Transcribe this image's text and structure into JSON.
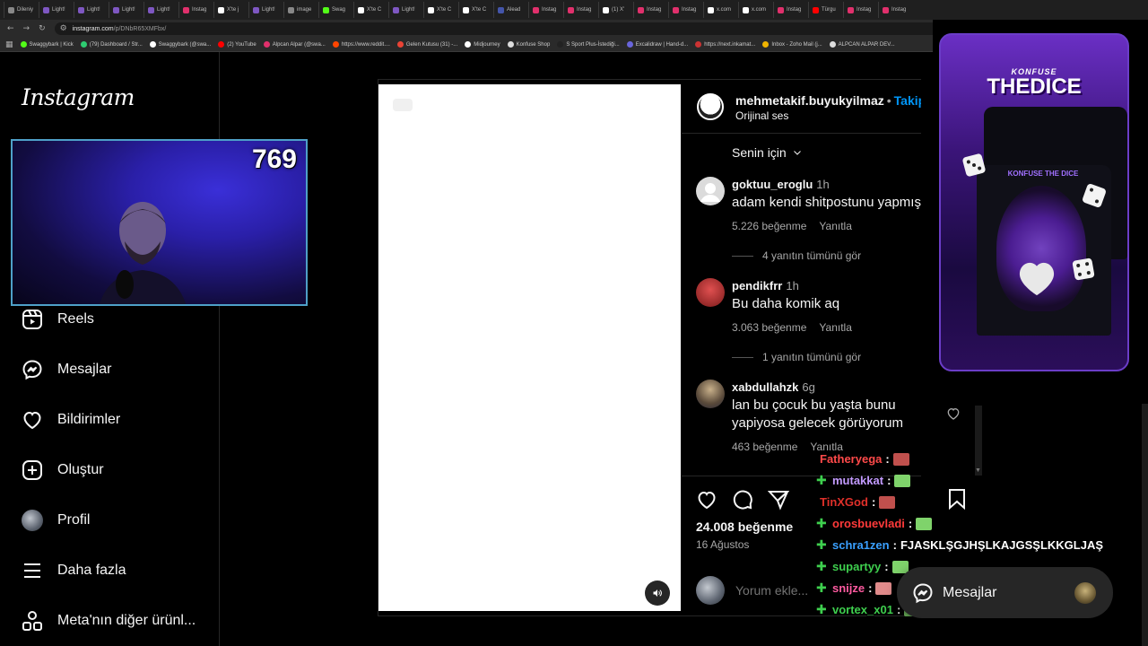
{
  "browser": {
    "tabs": [
      {
        "label": "Dileniy",
        "color": "#888888"
      },
      {
        "label": "Light!",
        "color": "#7e57c2"
      },
      {
        "label": "Light!",
        "color": "#7e57c2"
      },
      {
        "label": "Light!",
        "color": "#7e57c2"
      },
      {
        "label": "Light!",
        "color": "#7e57c2"
      },
      {
        "label": "Instag",
        "color": "#e1306c"
      },
      {
        "label": "X'te j",
        "color": "#ffffff"
      },
      {
        "label": "Light!",
        "color": "#7e57c2"
      },
      {
        "label": "image",
        "color": "#888888"
      },
      {
        "label": "Swag",
        "color": "#53fc18"
      },
      {
        "label": "X'te C",
        "color": "#ffffff"
      },
      {
        "label": "Light!",
        "color": "#7e57c2"
      },
      {
        "label": "X'te C",
        "color": "#ffffff"
      },
      {
        "label": "X'te C",
        "color": "#ffffff"
      },
      {
        "label": "Alead",
        "color": "#4455aa"
      },
      {
        "label": "Instag",
        "color": "#e1306c"
      },
      {
        "label": "Instag",
        "color": "#e1306c"
      },
      {
        "label": "(1) X'",
        "color": "#ffffff"
      },
      {
        "label": "Instag",
        "color": "#e1306c"
      },
      {
        "label": "Instag",
        "color": "#e1306c"
      },
      {
        "label": "x.com",
        "color": "#ffffff"
      },
      {
        "label": "x.com",
        "color": "#ffffff"
      },
      {
        "label": "Instag",
        "color": "#e1306c"
      },
      {
        "label": "Türgu",
        "color": "#ff0000"
      },
      {
        "label": "Instag",
        "color": "#e1306c"
      },
      {
        "label": "Instag",
        "color": "#e1306c"
      }
    ],
    "url_host": "instagram.com",
    "url_path": "/p/DNbR65XMFbx/",
    "bookmarks": [
      {
        "label": "Swaggybark | Kick",
        "color": "#53fc18"
      },
      {
        "label": "(79) Dashboard / Str...",
        "color": "#2ecc71"
      },
      {
        "label": "Swaggybark (@swa...",
        "color": "#ffffff"
      },
      {
        "label": "(2) YouTube",
        "color": "#ff0000"
      },
      {
        "label": "Alpcan Alpar (@swa...",
        "color": "#e1306c"
      },
      {
        "label": "https://www.reddit....",
        "color": "#ff4500"
      },
      {
        "label": "Gelen Kutusu (31) -...",
        "color": "#ea4335"
      },
      {
        "label": "Midjourney",
        "color": "#ffffff"
      },
      {
        "label": "Konfuse Shop",
        "color": "#dddddd"
      },
      {
        "label": "S Sport Plus-İstediği...",
        "color": "#222222"
      },
      {
        "label": "Excalidraw | Hand-d...",
        "color": "#6965db"
      },
      {
        "label": "https://next.inkamat...",
        "color": "#cc3333"
      },
      {
        "label": "Inbox - Zoho Mail (j...",
        "color": "#f0b400"
      },
      {
        "label": "ALPCAN ALPAR DEV...",
        "color": "#dddddd"
      }
    ]
  },
  "sidebar": {
    "logo": "Instagram",
    "items": [
      {
        "label": "Reels",
        "icon": "reels-icon"
      },
      {
        "label": "Mesajlar",
        "icon": "messenger-icon"
      },
      {
        "label": "Bildirimler",
        "icon": "heart-icon"
      },
      {
        "label": "Oluştur",
        "icon": "plus-square-icon"
      },
      {
        "label": "Profil",
        "icon": "avatar"
      },
      {
        "label": "Daha fazla",
        "icon": "menu-icon"
      },
      {
        "label": "Meta'nın diğer ürünl...",
        "icon": "meta-apps-icon"
      }
    ]
  },
  "stream": {
    "viewer_count": "769"
  },
  "post": {
    "username": "mehmetakif.buyukyilmaz",
    "follow_label": "Takip",
    "audio": "Orijinal ses",
    "sort_label": "Senin için",
    "comments": [
      {
        "user": "goktuu_eroglu",
        "time": "1h",
        "text": [
          "adam kendi shitpostunu yapmış"
        ],
        "likes": "5.226 beğenme",
        "reply": "Yanıtla",
        "replies": "4 yanıtın tümünü gör",
        "avatar_color": "#dbdbdb"
      },
      {
        "user": "pendikfrr",
        "time": "1h",
        "text": [
          "Bu daha komik aq"
        ],
        "likes": "3.063 beğenme",
        "reply": "Yanıtla",
        "replies": "1 yanıtın tümünü gör",
        "avatar_color": "#c0392b"
      },
      {
        "user": "xabdullahzk",
        "time": "6g",
        "text": [
          "lan bu çocuk bu yaşta bunu",
          "yapiyosa gelecek görüyorum"
        ],
        "likes": "463 beğenme",
        "reply": "Yanıtla",
        "replies": "",
        "avatar_color": "#8a7a60"
      }
    ],
    "likes_count": "24.008 beğenme",
    "date": "16 Ağustos",
    "comment_placeholder": "Yorum ekle..."
  },
  "chat": [
    {
      "user": "Fatheryega",
      "color": "#ff4a4a",
      "message": "",
      "badge": false,
      "emote_color": "#c0504d"
    },
    {
      "user": "mutakkat",
      "color": "#c39bff",
      "message": "",
      "badge": true,
      "emote_color": "#7fd36b"
    },
    {
      "user": "TinXGod",
      "color": "#e0302a",
      "message": "",
      "badge": false,
      "emote_color": "#c0504d"
    },
    {
      "user": "orosbuevladi",
      "color": "#ff3a3a",
      "message": "",
      "badge": true,
      "emote_color": "#7fd36b"
    },
    {
      "user": "schra1zen",
      "color": "#3aa0ff",
      "message": "FJASKLŞGJHŞLKAJGSŞLKKGLJAŞ",
      "badge": true,
      "emote_color": ""
    },
    {
      "user": "supartyy",
      "color": "#3ecf4e",
      "message": "",
      "badge": true,
      "emote_color": "#7fd36b"
    },
    {
      "user": "snijze",
      "color": "#ff5aa0",
      "message": "",
      "badge": true,
      "emote_color": "#e08b8b"
    },
    {
      "user": "vortex_x01",
      "color": "#3ecf4e",
      "message": "",
      "badge": true,
      "emote_color": "#7fd36b"
    }
  ],
  "ad": {
    "brand": "KONFUSE",
    "title": "THEDICE",
    "print_text": "KONFUSE THE DICE"
  },
  "messages_float": {
    "label": "Mesajlar"
  }
}
